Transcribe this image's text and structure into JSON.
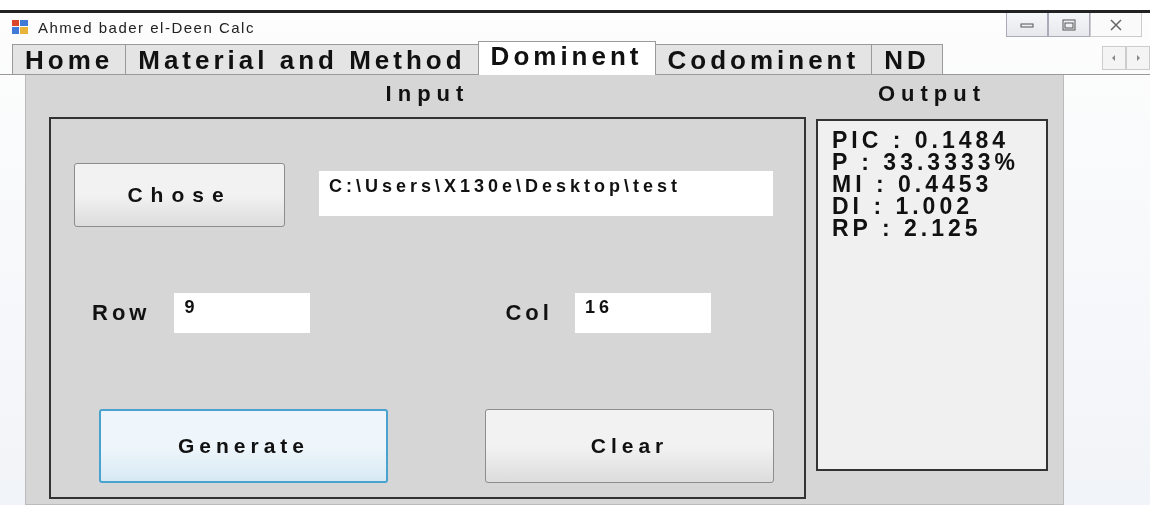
{
  "window": {
    "title": "Ahmed bader el-Deen Calc"
  },
  "tabs": [
    {
      "label": "Home",
      "selected": false
    },
    {
      "label": "Material and Method",
      "selected": false
    },
    {
      "label": "Dominent",
      "selected": true
    },
    {
      "label": "Codominent",
      "selected": false
    },
    {
      "label": "ND",
      "selected": false
    }
  ],
  "input": {
    "heading": "Input",
    "chose_button": "Chose",
    "path_field": {
      "value": "C:\\Users\\X130e\\Desktop\\test"
    },
    "row_label": "Row",
    "row_field": {
      "value": "9"
    },
    "col_label": "Col",
    "col_field": {
      "value": "16"
    },
    "generate_button": {
      "label": "Generate",
      "focused": true
    },
    "clear_button": {
      "label": "Clear",
      "focused": false
    }
  },
  "output": {
    "heading": "Output",
    "lines": [
      "PIC : 0.1484",
      "P : 33.3333%",
      "MI : 0.4453",
      "DI : 1.002",
      "RP : 2.125"
    ]
  }
}
